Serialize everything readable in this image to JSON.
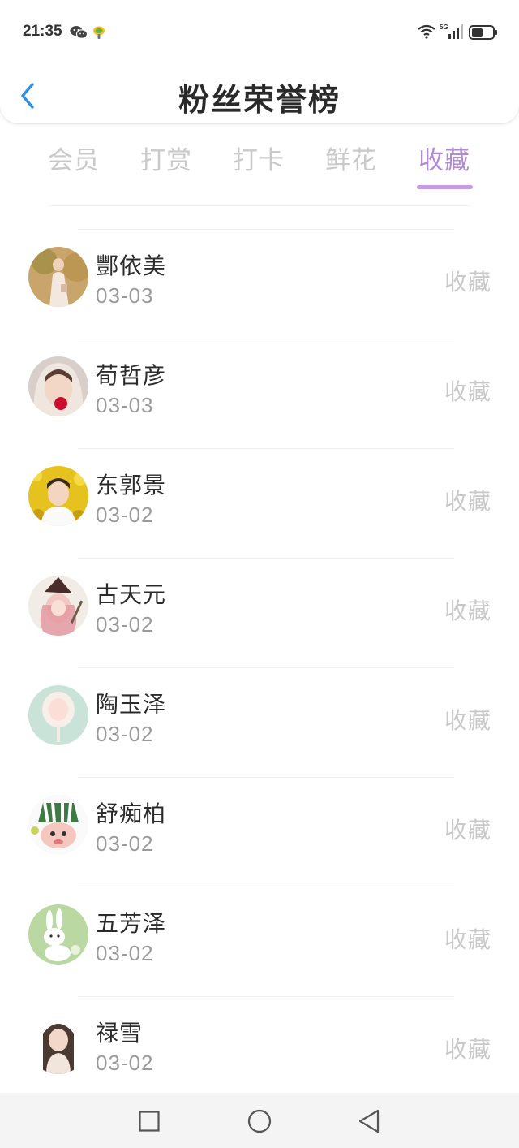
{
  "status_bar": {
    "time": "21:35",
    "icons": [
      "wechat-icon",
      "app-status-icon",
      "wifi-icon",
      "signal-5g-icon",
      "battery-icon"
    ],
    "network": "5G"
  },
  "header": {
    "title": "粉丝荣誉榜",
    "back_icon": "chevron-left-icon",
    "accent_color": "#2f8fe0"
  },
  "tabs": {
    "items": [
      {
        "label": "会员",
        "active": false
      },
      {
        "label": "打赏",
        "active": false
      },
      {
        "label": "打卡",
        "active": false
      },
      {
        "label": "鲜花",
        "active": false
      },
      {
        "label": "收藏",
        "active": true
      }
    ],
    "active_color": "#b38ad6",
    "inactive_color": "#c9c9c9"
  },
  "list": {
    "rows": [
      {
        "name": "酆依美",
        "date": "03-03",
        "action": "收藏",
        "avatar": "avatar-girl-garden"
      },
      {
        "name": "荀哲彦",
        "date": "03-03",
        "action": "收藏",
        "avatar": "avatar-girl-hood"
      },
      {
        "name": "东郭景",
        "date": "03-02",
        "action": "收藏",
        "avatar": "avatar-boy-sunflowers"
      },
      {
        "name": "古天元",
        "date": "03-02",
        "action": "收藏",
        "avatar": "avatar-anime-witch"
      },
      {
        "name": "陶玉泽",
        "date": "03-02",
        "action": "收藏",
        "avatar": "avatar-cotton-candy"
      },
      {
        "name": "舒痴柏",
        "date": "03-02",
        "action": "收藏",
        "avatar": "avatar-cartoon-hat"
      },
      {
        "name": "五芳泽",
        "date": "03-02",
        "action": "收藏",
        "avatar": "avatar-bunny-green"
      },
      {
        "name": "禄雪",
        "date": "03-02",
        "action": "收藏",
        "avatar": "avatar-girl-portrait"
      }
    ]
  },
  "nav_bar": {
    "icons": [
      "recent-apps-icon",
      "home-icon",
      "back-icon"
    ]
  }
}
